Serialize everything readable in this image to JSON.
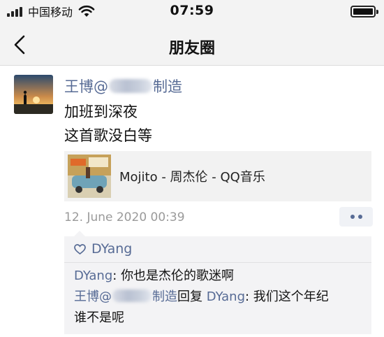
{
  "status_bar": {
    "carrier": "中国移动",
    "time": "07:59",
    "signal_bars": 4,
    "battery_level": 1.0,
    "icons": [
      "signal-icon",
      "wifi-icon",
      "battery-icon"
    ]
  },
  "nav": {
    "title": "朋友圈",
    "back_icon": "chevron-left-icon"
  },
  "post": {
    "author_name": "王博@",
    "author_suffix": "制造",
    "lines": [
      "加班到深夜",
      "这首歌没白等"
    ],
    "shared_music": {
      "title": "Mojito - 周杰伦 - QQ音乐"
    },
    "timestamp": "12. June 2020 00:39",
    "more_icon": "more-dots-icon"
  },
  "likes": {
    "icon": "heart-icon",
    "names": "DYang"
  },
  "comments": [
    {
      "author": "DYang",
      "separator": ": ",
      "text": "你也是杰伦的歌迷啊"
    },
    {
      "author_prefix": "王博@",
      "author_suffix": "制造",
      "reply_word": "回复",
      "reply_to": "DYang",
      "separator": ": ",
      "text_line1": "我们这个年纪",
      "text_line2": "谁不是呢"
    }
  ],
  "colors": {
    "link_blue": "#576b95",
    "timestamp_gray": "#9a9a9a",
    "bar_background": "#f3f3f3",
    "card_background": "#f2f2f2"
  }
}
